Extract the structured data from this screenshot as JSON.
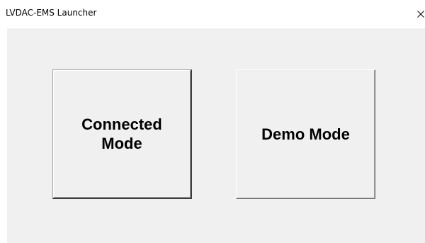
{
  "window": {
    "title": "LVDAC-EMS Launcher"
  },
  "buttons": {
    "connected_label": "Connected\nMode",
    "demo_label": "Demo Mode"
  },
  "icons": {
    "close": "close-icon"
  }
}
